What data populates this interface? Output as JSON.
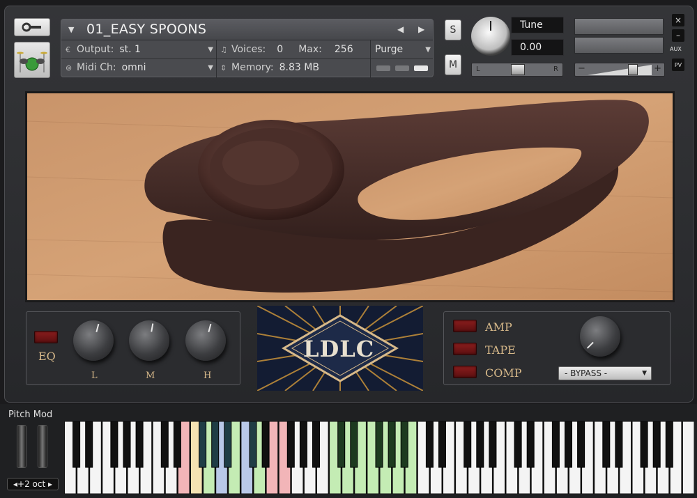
{
  "header": {
    "instrument_name": "01_EASY SPOONS",
    "output_label": "Output:",
    "output_value": "st. 1",
    "midi_label": "Midi Ch:",
    "midi_value": "omni",
    "voices_label": "Voices:",
    "voices_value": "0",
    "max_label": "Max:",
    "max_value": "256",
    "memory_label": "Memory:",
    "memory_value": "8.83 MB",
    "purge_label": "Purge"
  },
  "controls": {
    "solo_label": "S",
    "mute_label": "M",
    "tune_label": "Tune",
    "tune_value": "0.00",
    "pan_left": "L",
    "pan_right": "R",
    "vol_minus": "−",
    "vol_plus": "+",
    "close_label": "×",
    "minimize_label": "–",
    "aux_label": "AUX",
    "pv_label": "PV"
  },
  "eq": {
    "eq_label": "EQ",
    "low_label": "L",
    "mid_label": "M",
    "high_label": "H"
  },
  "logo": {
    "text": "LDLC"
  },
  "fx": {
    "amp_label": "AMP",
    "tape_label": "TAPE",
    "comp_label": "COMP",
    "bypass_value": "- BYPASS -"
  },
  "keyboard": {
    "pitch_mod_label": "Pitch Mod",
    "octave_label": "◂+2 oct ▸"
  },
  "colors": {
    "accent_red": "#7a1818",
    "logo_gold": "#d7b98a",
    "key_pink": "#f2b5b8",
    "key_yellow": "#f4e2b2",
    "key_blue": "#b9c8e8",
    "key_green": "#c4ecb4"
  }
}
